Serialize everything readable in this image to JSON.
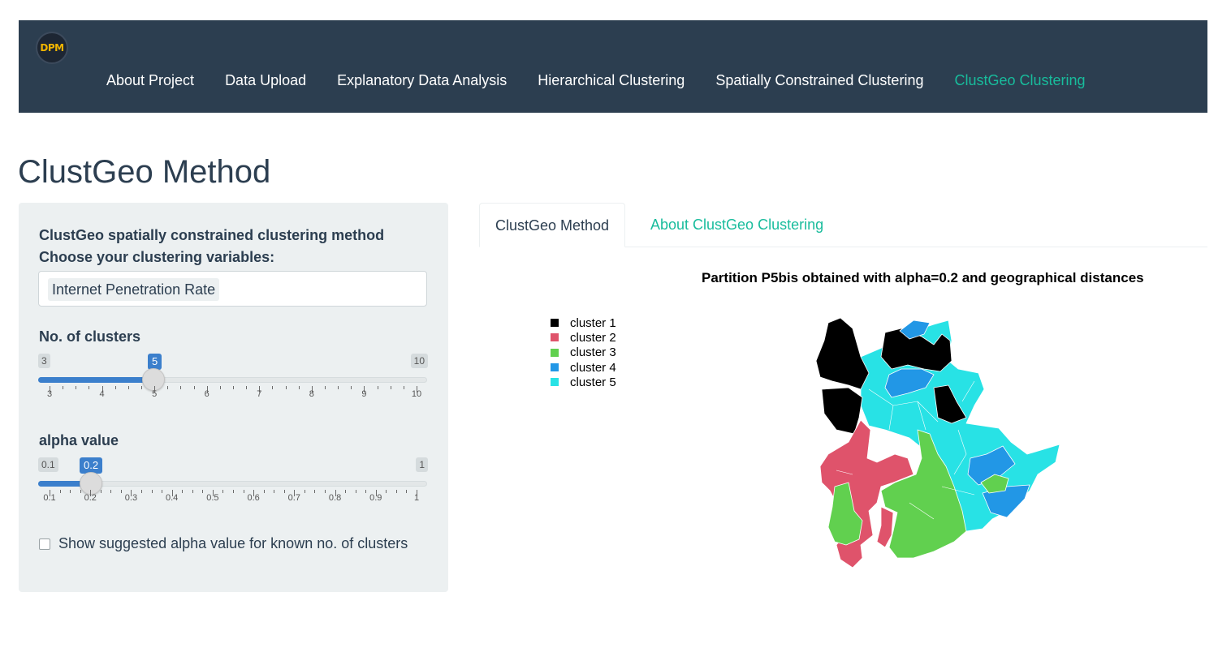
{
  "navbar": {
    "logo_text": "DPM",
    "items": [
      {
        "label": "About Project",
        "active": false
      },
      {
        "label": "Data Upload",
        "active": false
      },
      {
        "label": "Explanatory Data Analysis",
        "active": false
      },
      {
        "label": "Hierarchical Clustering",
        "active": false
      },
      {
        "label": "Spatially Constrained Clustering",
        "active": false
      },
      {
        "label": "ClustGeo Clustering",
        "active": true
      }
    ]
  },
  "page": {
    "title": "ClustGeo Method"
  },
  "sidebar": {
    "heading_line1": "ClustGeo spatially constrained clustering method",
    "heading_line2": "Choose your clustering variables:",
    "selected_variable": "Internet Penetration Rate",
    "clusters_slider": {
      "label": "No. of clusters",
      "min": "3",
      "max": "10",
      "value": "5",
      "ticks": [
        "3",
        "4",
        "5",
        "6",
        "7",
        "8",
        "9",
        "10"
      ]
    },
    "alpha_slider": {
      "label": "alpha value",
      "min": "0.1",
      "max": "1",
      "value": "0.2",
      "ticks": [
        "0.1",
        "0.2",
        "0.3",
        "0.4",
        "0.5",
        "0.6",
        "0.7",
        "0.8",
        "0.9",
        "1"
      ]
    },
    "checkbox_label": "Show suggested alpha value for known no. of clusters",
    "checkbox_checked": false
  },
  "tabs": [
    {
      "label": "ClustGeo Method",
      "active": true
    },
    {
      "label": "About ClustGeo Clustering",
      "active": false
    }
  ],
  "plot": {
    "title": "Partition P5bis obtained with alpha=0.2 and geographical distances",
    "legend": [
      {
        "label": "cluster 1",
        "color": "#000000"
      },
      {
        "label": "cluster 2",
        "color": "#df536b"
      },
      {
        "label": "cluster 3",
        "color": "#61d04f"
      },
      {
        "label": "cluster 4",
        "color": "#2297e6"
      },
      {
        "label": "cluster 5",
        "color": "#28e2e5"
      }
    ]
  },
  "colors": {
    "navbar_bg": "#2c3e50",
    "accent": "#18bc9c",
    "slider_blue": "#3b7fcc",
    "sidebar_bg": "#ecf0f1"
  }
}
